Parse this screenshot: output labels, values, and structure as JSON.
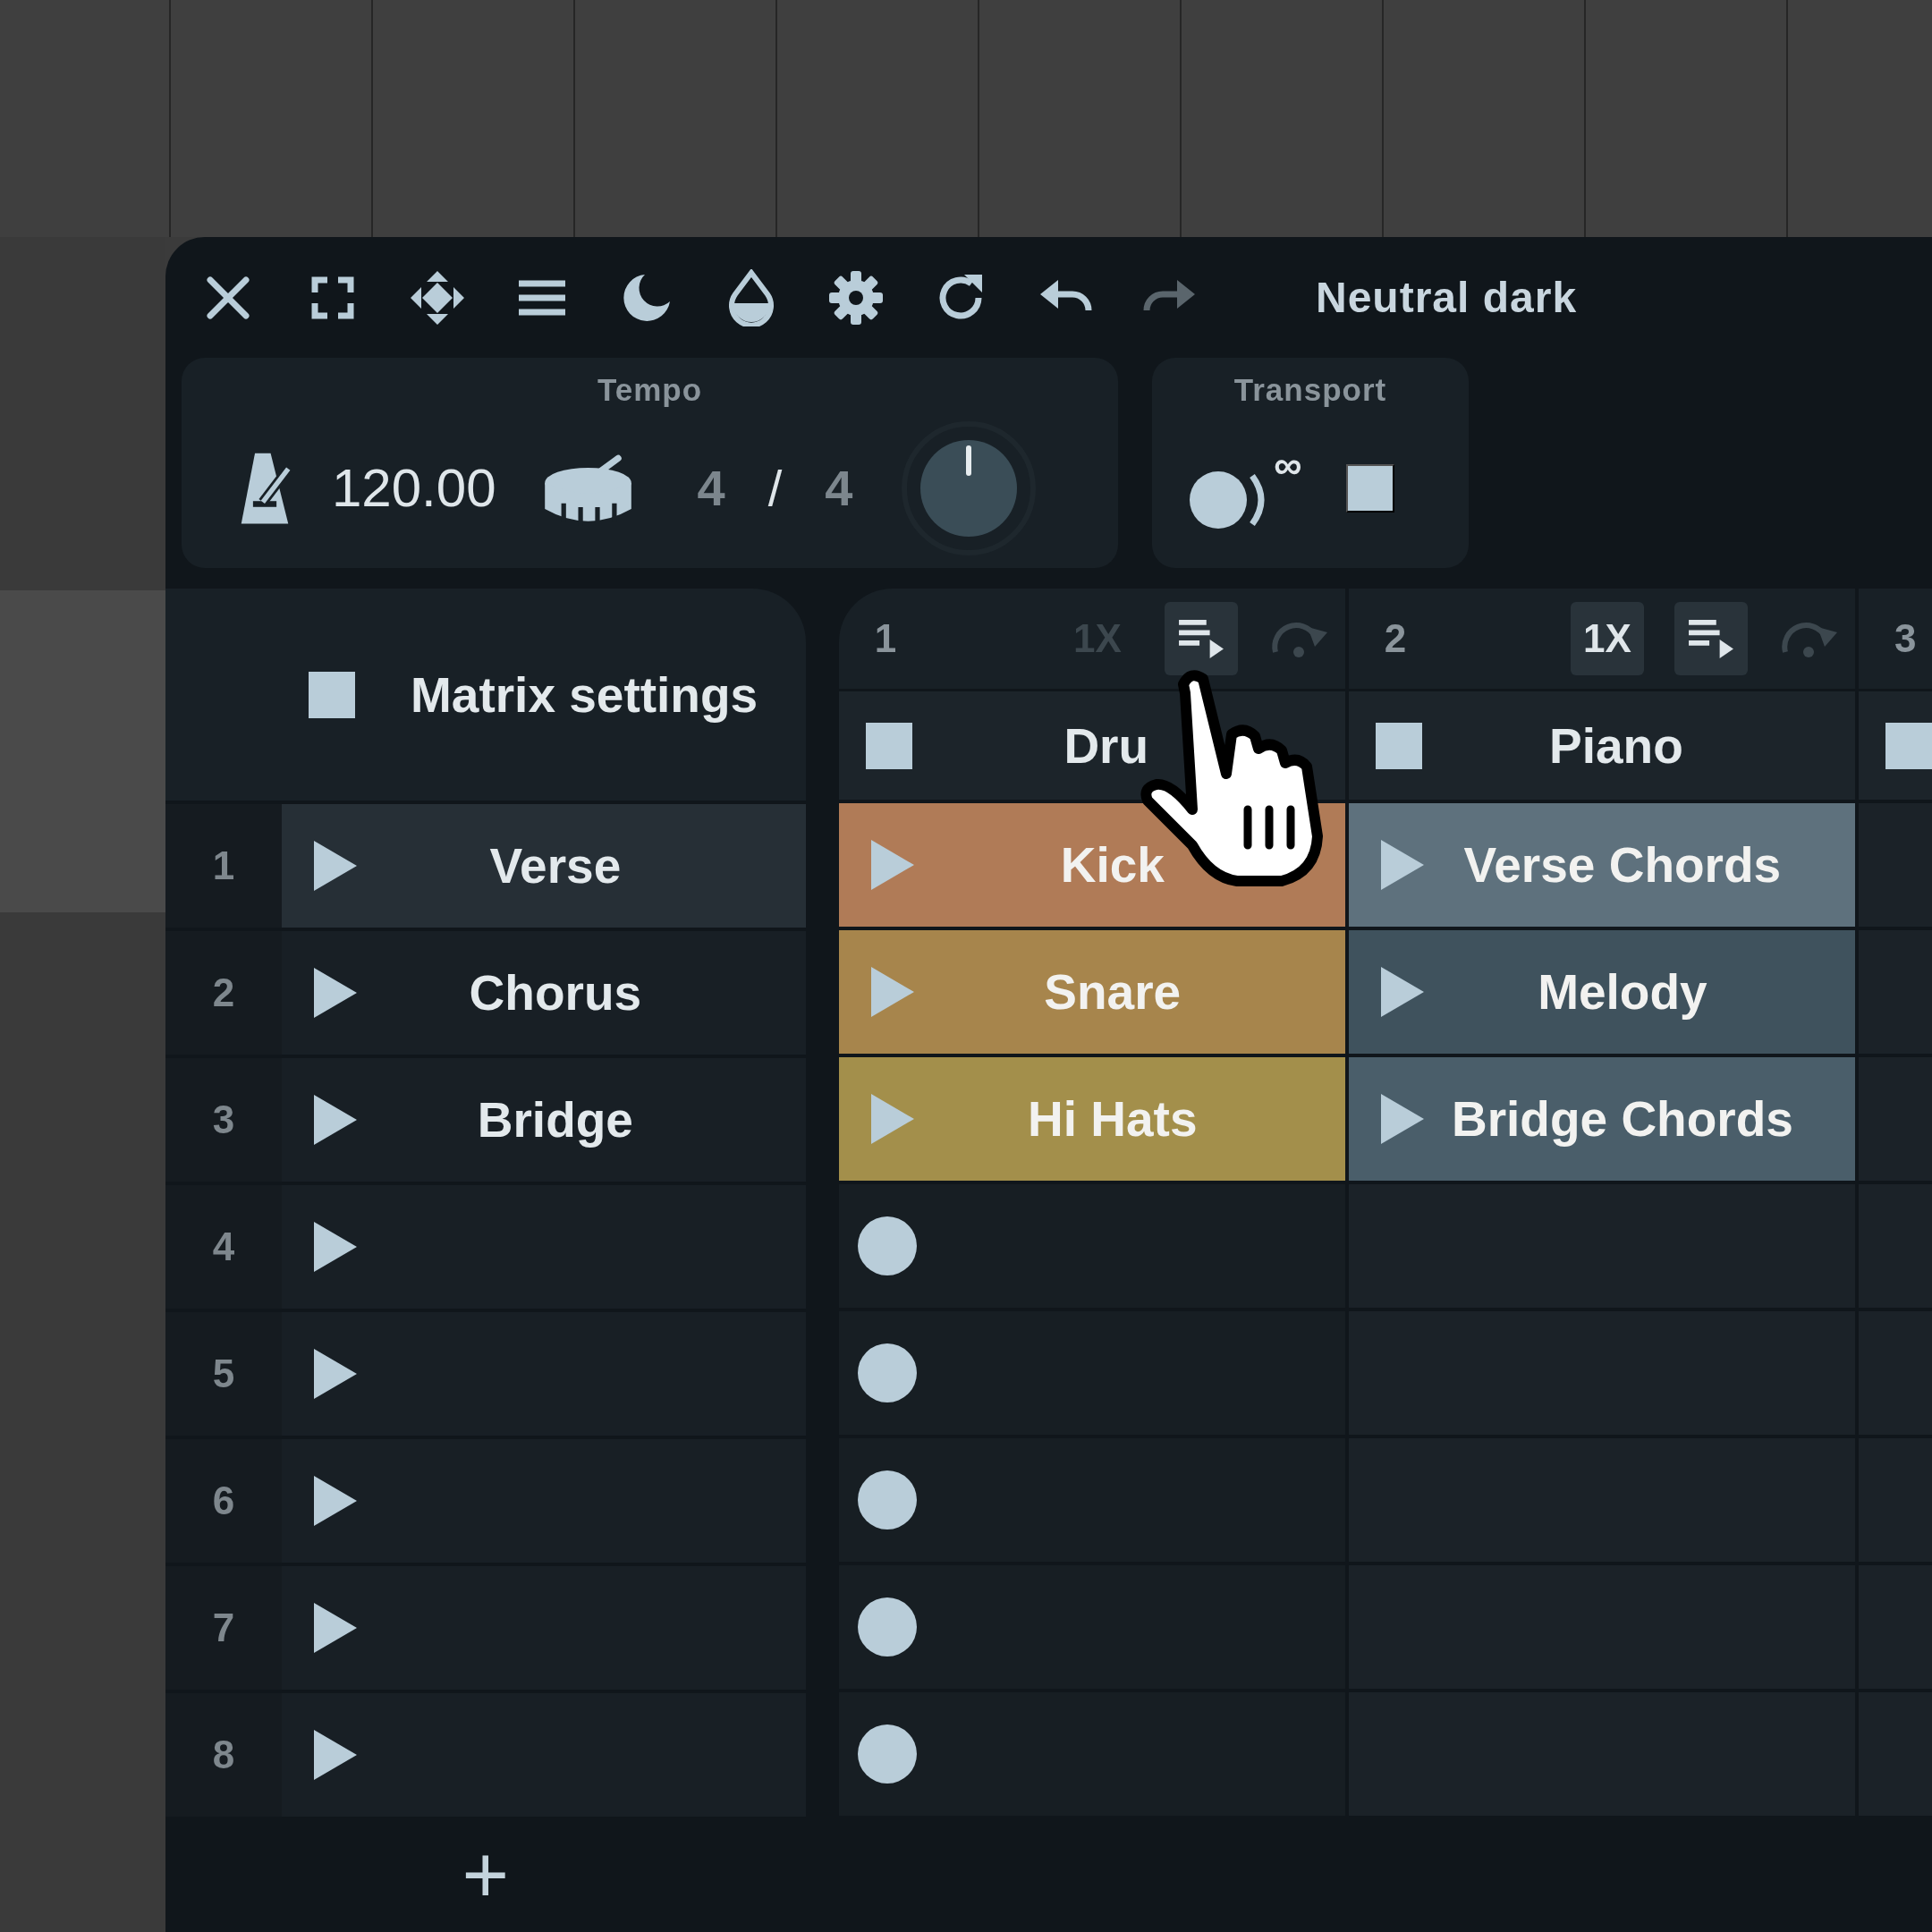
{
  "toolbar": {
    "buttons": [
      {
        "kind": "close",
        "disabled": false
      },
      {
        "kind": "fullscreen",
        "disabled": false
      },
      {
        "kind": "move",
        "disabled": false
      },
      {
        "kind": "menu",
        "disabled": false
      },
      {
        "kind": "moon",
        "disabled": false
      },
      {
        "kind": "drop",
        "disabled": false
      },
      {
        "kind": "settings",
        "disabled": false
      },
      {
        "kind": "refresh",
        "disabled": false
      },
      {
        "kind": "undo",
        "disabled": false
      },
      {
        "kind": "redo",
        "disabled": true
      }
    ],
    "theme": "Neutral dark"
  },
  "tempo": {
    "title": "Tempo",
    "bpm": "120.00",
    "numerator": "4",
    "separator": "/",
    "denominator": "4"
  },
  "transport": {
    "title": "Transport",
    "loop_mark": "∞"
  },
  "matrix": {
    "title": "Matrix settings",
    "add": "+",
    "scenes": [
      {
        "number": "1",
        "name": "Verse",
        "selected": true
      },
      {
        "number": "2",
        "name": "Chorus",
        "selected": false
      },
      {
        "number": "3",
        "name": "Bridge",
        "selected": false
      },
      {
        "number": "4",
        "selected": false
      },
      {
        "number": "5",
        "selected": false
      },
      {
        "number": "6",
        "selected": false
      },
      {
        "number": "7",
        "selected": false
      },
      {
        "number": "8",
        "selected": false
      }
    ]
  },
  "tracks": [
    {
      "number": "1",
      "repeat": "1X",
      "repeat_on": false,
      "queue_on": true,
      "follow_on": false,
      "name": "Dru",
      "slots": [
        {
          "kind": "clip",
          "name": "Kick",
          "color": "#b07b57"
        },
        {
          "kind": "clip",
          "name": "Snare",
          "color": "#a7854c"
        },
        {
          "kind": "clip",
          "name": "Hi Hats",
          "color": "#a38f4b"
        },
        {
          "kind": "record"
        },
        {
          "kind": "record"
        },
        {
          "kind": "record"
        },
        {
          "kind": "record"
        },
        {
          "kind": "record"
        }
      ]
    },
    {
      "number": "2",
      "repeat": "1X",
      "repeat_on": true,
      "queue_on": true,
      "follow_on": false,
      "name": "Piano",
      "slots": [
        {
          "kind": "clip",
          "name": "Verse Chords",
          "color": "#5e717d"
        },
        {
          "kind": "clip",
          "name": "Melody",
          "color": "#3f525d"
        },
        {
          "kind": "clip",
          "name": "Bridge Chords",
          "color": "#4a5e6a"
        },
        {
          "kind": "empty"
        },
        {
          "kind": "empty"
        },
        {
          "kind": "empty"
        },
        {
          "kind": "empty"
        },
        {
          "kind": "empty"
        }
      ]
    },
    {
      "number": "3",
      "slots": [
        {
          "kind": "empty"
        },
        {
          "kind": "empty"
        },
        {
          "kind": "empty"
        },
        {
          "kind": "empty"
        },
        {
          "kind": "empty"
        },
        {
          "kind": "empty"
        },
        {
          "kind": "empty"
        },
        {
          "kind": "empty"
        }
      ]
    }
  ]
}
